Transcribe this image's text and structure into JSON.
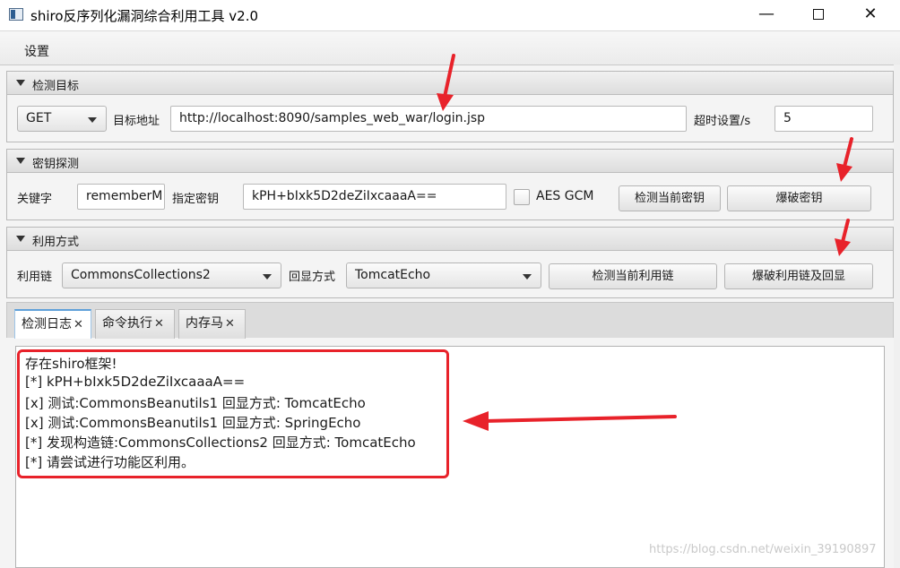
{
  "window": {
    "title": "shiro反序列化漏洞综合利用工具 v2.0",
    "minimize_glyph": "—",
    "close_glyph": "✕"
  },
  "menu": {
    "settings": "设置"
  },
  "target_section": {
    "title": "检测目标",
    "method": "GET",
    "url_label": "目标地址",
    "url_value": "http://localhost:8090/samples_web_war/login.jsp",
    "timeout_label": "超时设置/s",
    "timeout_value": "5"
  },
  "key_section": {
    "title": "密钥探测",
    "keyword_label": "关键字",
    "keyword_value": "rememberM",
    "key_label": "指定密钥",
    "key_value": "kPH+bIxk5D2deZiIxcaaaA==",
    "aes_gcm_label": "AES GCM",
    "check_key_button": "检测当前密钥",
    "brute_key_button": "爆破密钥"
  },
  "exploit_section": {
    "title": "利用方式",
    "chain_label": "利用链",
    "chain_value": "CommonsCollections2",
    "echo_label": "回显方式",
    "echo_value": "TomcatEcho",
    "check_chain_button": "检测当前利用链",
    "brute_chain_button": "爆破利用链及回显"
  },
  "tabs": [
    {
      "label": "检测日志",
      "close": "✕"
    },
    {
      "label": "命令执行",
      "close": "✕"
    },
    {
      "label": "内存马",
      "close": "✕"
    }
  ],
  "log_lines": [
    "存在shiro框架!",
    "[*] kPH+bIxk5D2deZiIxcaaaA==",
    "[x] 测试:CommonsBeanutils1  回显方式: TomcatEcho",
    "[x] 测试:CommonsBeanutils1  回显方式: SpringEcho",
    "[*] 发现构造链:CommonsCollections2  回显方式: TomcatEcho",
    "[*] 请尝试进行功能区利用。"
  ],
  "watermark": "https://blog.csdn.net/weixin_39190897",
  "colors": {
    "annotation_red": "#e8222a",
    "tab_accent": "#5fa0d9"
  },
  "icons": [
    "app-icon",
    "minimize-icon",
    "maximize-icon",
    "close-icon",
    "collapse-arrow-icon",
    "dropdown-arrow-icon",
    "tab-close-icon"
  ]
}
